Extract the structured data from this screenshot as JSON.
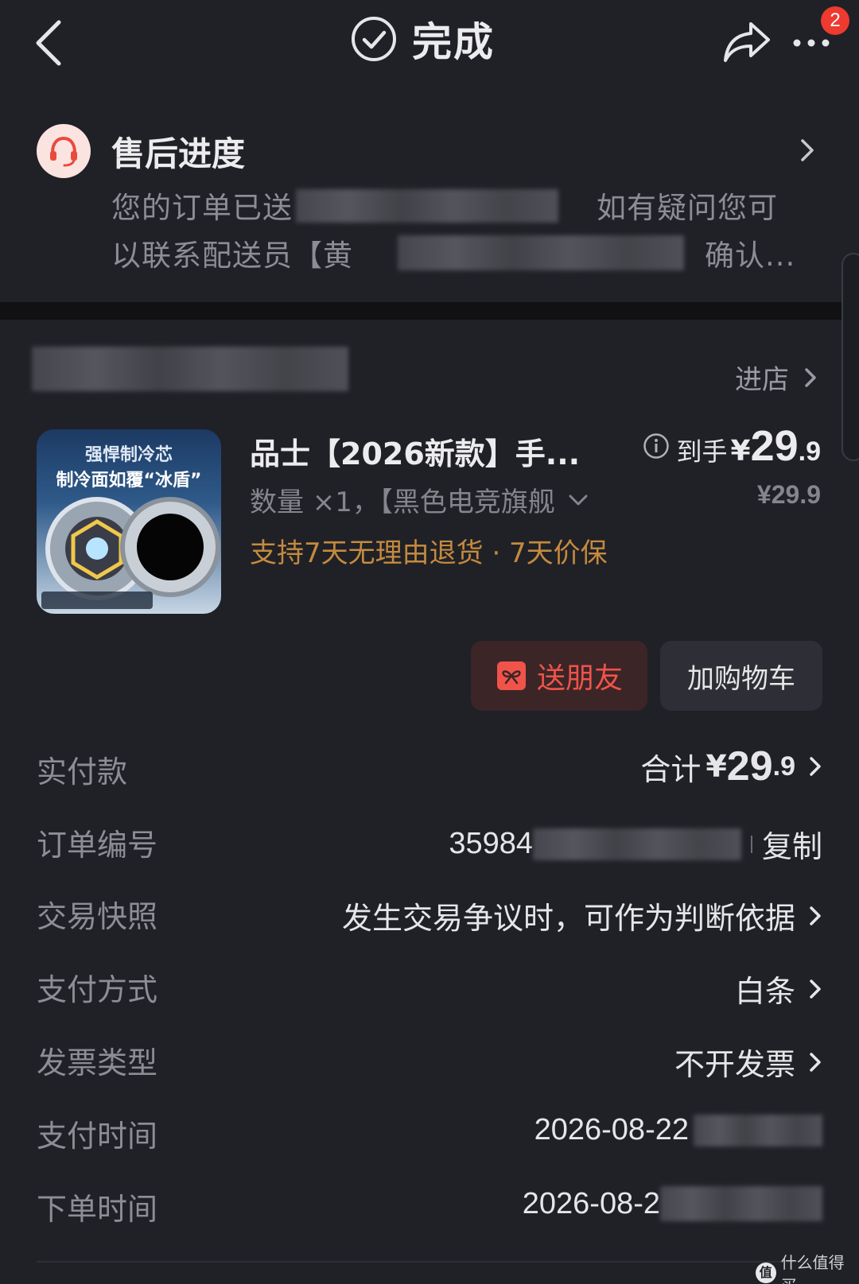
{
  "header": {
    "title": "完成",
    "badge_count": "2"
  },
  "aftersale": {
    "title": "售后进度",
    "desc_line1_a": "您的订单已送",
    "desc_line1_b": "如有疑问您可",
    "desc_line2_a": "以联系配送员【黄",
    "desc_line2_b": "确认..."
  },
  "store": {
    "go_label": "进店"
  },
  "product": {
    "title": "品士【2026新款】手...",
    "spec": "数量 ×1，【黑色电竞旗舰",
    "promo": "支持7天无理由退货 · 7天价保",
    "price_label": "到手",
    "price_currency": "¥",
    "price_int": "29",
    "price_dec": ".9",
    "price_original": "¥29.9",
    "image_text_line1": "强悍制冷芯",
    "image_text_line2": "制冷面如覆“冰盾”"
  },
  "actions": {
    "gift_label": "送朋友",
    "cart_label": "加购物车"
  },
  "info": {
    "paid_label": "实付款",
    "paid_prefix": "合计",
    "paid_currency": "¥",
    "paid_int": "29",
    "paid_dec": ".9",
    "order_no_label": "订单编号",
    "order_no_visible": "35984",
    "copy_label": "复制",
    "snapshot_label": "交易快照",
    "snapshot_value": "发生交易争议时，可作为判断依据",
    "payment_label": "支付方式",
    "payment_value": "白条",
    "invoice_label": "发票类型",
    "invoice_value": "不开发票",
    "pay_time_label": "支付时间",
    "pay_time_visible": "2026-08-22",
    "order_time_label": "下单时间",
    "order_time_visible": "2026-08-2"
  },
  "watermark": {
    "text": "什么值得买",
    "icon_char": "值"
  },
  "colors": {
    "background": "#202127",
    "accent_red": "#ee3a2f",
    "promo_orange": "#c58a3e",
    "muted_text": "#8d8d95"
  },
  "icons": [
    "back-icon",
    "check-circle-icon",
    "share-icon",
    "more-icon",
    "customer-service-icon",
    "chevron-right-icon",
    "info-icon",
    "gift-icon",
    "chevron-down-icon"
  ]
}
